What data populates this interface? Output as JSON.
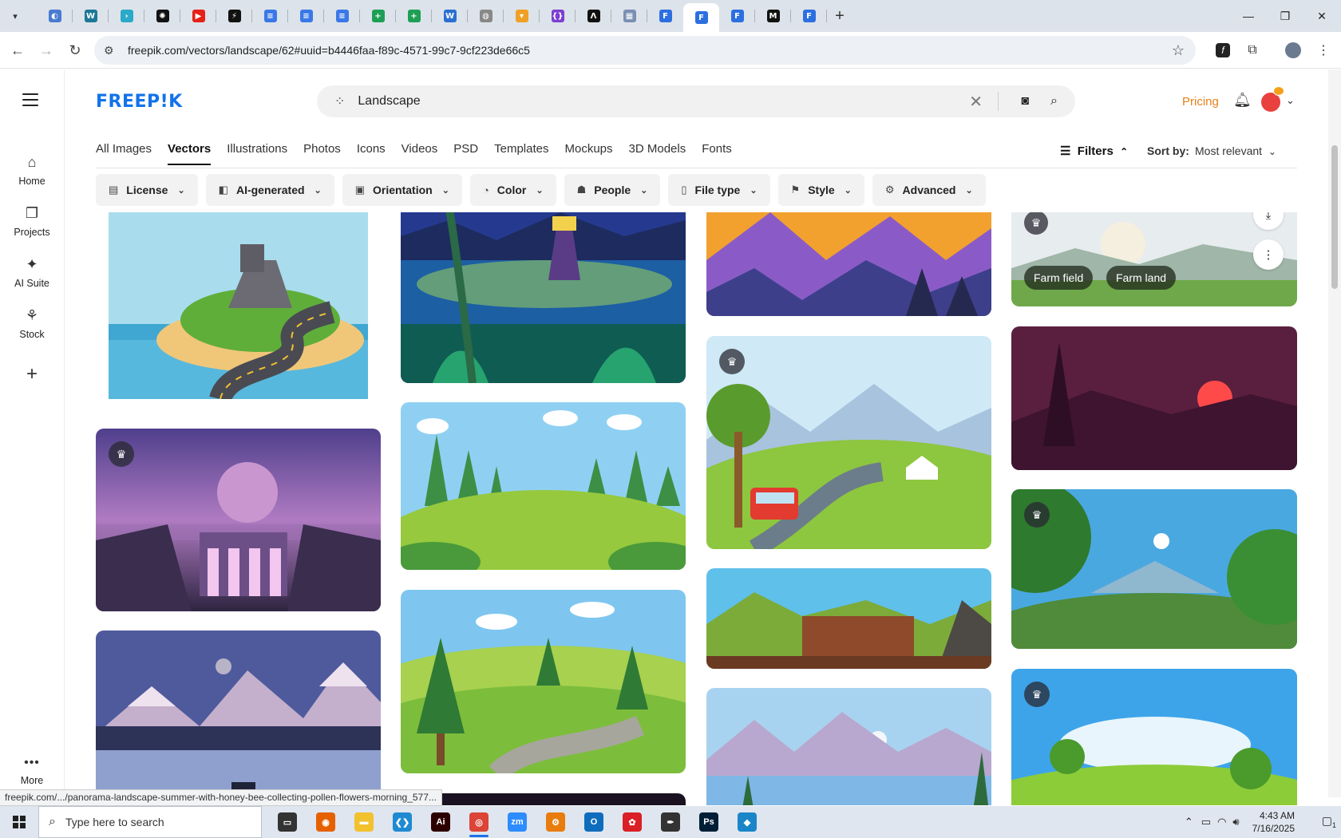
{
  "browser": {
    "tabs": [
      {
        "icon": "globe-icon",
        "color": "#4a7bd1",
        "glyph": "◐"
      },
      {
        "icon": "wordpress-icon",
        "color": "#1c7896",
        "glyph": "W"
      },
      {
        "icon": "arrow-icon",
        "color": "#2aa9c9",
        "glyph": "›"
      },
      {
        "icon": "openai-icon",
        "color": "#111111",
        "glyph": "✺"
      },
      {
        "icon": "youtube-icon",
        "color": "#e62117",
        "glyph": "▶"
      },
      {
        "icon": "bolt-icon",
        "color": "#111111",
        "glyph": "⚡"
      },
      {
        "icon": "docs-icon",
        "color": "#3b78e7",
        "glyph": "≡"
      },
      {
        "icon": "docs-icon",
        "color": "#3b78e7",
        "glyph": "≡"
      },
      {
        "icon": "docs-icon",
        "color": "#3b78e7",
        "glyph": "≡"
      },
      {
        "icon": "sheets-icon",
        "color": "#1e9f55",
        "glyph": "+"
      },
      {
        "icon": "sheets-icon",
        "color": "#1e9f55",
        "glyph": "+"
      },
      {
        "icon": "word-icon",
        "color": "#2b6fd1",
        "glyph": "W"
      },
      {
        "icon": "globe-icon",
        "color": "#888888",
        "glyph": "◍"
      },
      {
        "icon": "tabler-icon",
        "color": "#f0a024",
        "glyph": "▾"
      },
      {
        "icon": "braces-icon",
        "color": "#7b3fd1",
        "glyph": "{}"
      },
      {
        "icon": "lambda-icon",
        "color": "#111111",
        "glyph": "Λ"
      },
      {
        "icon": "grid-icon",
        "color": "#7a8fb3",
        "glyph": "▦"
      },
      {
        "icon": "freepik-tab-icon",
        "color": "#2d6fe0",
        "glyph": "F"
      },
      {
        "icon": "freepik-tab-icon",
        "color": "#2d6fe0",
        "glyph": "F"
      },
      {
        "icon": "freepik-tab-icon",
        "color": "#2d6fe0",
        "glyph": "F"
      },
      {
        "icon": "m-icon",
        "color": "#111111",
        "glyph": "M"
      },
      {
        "icon": "freepik-tab-icon",
        "color": "#2d6fe0",
        "glyph": "F"
      }
    ],
    "active_tab_index": 18,
    "url": "freepik.com/vectors/landscape/62#uuid=b4446faa-f89c-4571-99c7-9cf223de66c5"
  },
  "rail": {
    "items": [
      {
        "label": "Home",
        "icon": "⌂"
      },
      {
        "label": "Projects",
        "icon": "❐"
      },
      {
        "label": "AI Suite",
        "icon": "✦"
      },
      {
        "label": "Stock",
        "icon": "⚘"
      }
    ],
    "add_icon": "+",
    "more_label": "More"
  },
  "header": {
    "logo": "FREEP!K",
    "search_value": "Landscape",
    "pricing": "Pricing"
  },
  "categories": [
    "All Images",
    "Vectors",
    "Illustrations",
    "Photos",
    "Icons",
    "Videos",
    "PSD",
    "Templates",
    "Mockups",
    "3D Models",
    "Fonts"
  ],
  "active_category": "Vectors",
  "filters_label": "Filters",
  "sort": {
    "label": "Sort by:",
    "value": "Most relevant"
  },
  "filter_pills": [
    {
      "label": "License",
      "icon": "▤"
    },
    {
      "label": "AI-generated",
      "icon": "◧"
    },
    {
      "label": "Orientation",
      "icon": "▣"
    },
    {
      "label": "Color",
      "icon": "◔"
    },
    {
      "label": "People",
      "icon": "☗"
    },
    {
      "label": "File type",
      "icon": "▯"
    },
    {
      "label": "Style",
      "icon": "⚑"
    },
    {
      "label": "Advanced",
      "icon": "⚙"
    }
  ],
  "hover_tags": [
    "Farm field",
    "Farm land"
  ],
  "status_url": "freepik.com/.../panorama-landscape-summer-with-honey-bee-collecting-pollen-flowers-morning_577...",
  "taskbar": {
    "search_placeholder": "Type here to search",
    "time": "4:43 AM",
    "date": "7/16/2025",
    "apps": [
      {
        "name": "task-view",
        "color": "#333333",
        "glyph": "▭",
        "active": false
      },
      {
        "name": "firefox",
        "color": "#e66000",
        "glyph": "◉",
        "active": false
      },
      {
        "name": "file-explorer",
        "color": "#f2c12e",
        "glyph": "▬",
        "active": false
      },
      {
        "name": "vscode",
        "color": "#1f8ad2",
        "glyph": "❮❯",
        "active": false
      },
      {
        "name": "illustrator",
        "color": "#2d0000",
        "glyph": "Ai",
        "active": false
      },
      {
        "name": "chrome",
        "color": "#db4437",
        "glyph": "◎",
        "active": true
      },
      {
        "name": "zoom",
        "color": "#2d8cff",
        "glyph": "zm",
        "active": false
      },
      {
        "name": "blender",
        "color": "#e87d0d",
        "glyph": "⚙",
        "active": false
      },
      {
        "name": "outlook",
        "color": "#0f6cbd",
        "glyph": "O",
        "active": false
      },
      {
        "name": "creative-cloud",
        "color": "#da1f26",
        "glyph": "✿",
        "active": false
      },
      {
        "name": "inkscape",
        "color": "#333333",
        "glyph": "✒",
        "active": false
      },
      {
        "name": "photoshop",
        "color": "#001e36",
        "glyph": "Ps",
        "active": false
      },
      {
        "name": "app-blue",
        "color": "#1a86c9",
        "glyph": "◆",
        "active": false
      }
    ],
    "notification_count": "1"
  }
}
